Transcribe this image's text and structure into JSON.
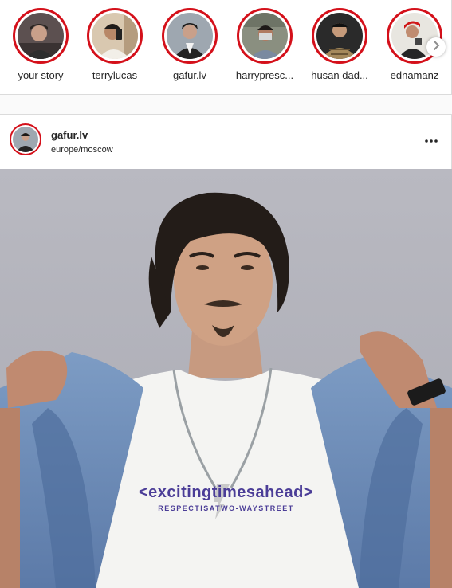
{
  "stories": [
    {
      "label": "your story",
      "avatar_bg": "#5c5050",
      "skin": "#c9a08a"
    },
    {
      "label": "terrylucas",
      "avatar_bg": "#d9c8b0",
      "skin": "#b88868"
    },
    {
      "label": "gafur.lv",
      "avatar_bg": "#9ea7b0",
      "skin": "#c9a08a"
    },
    {
      "label": "harrypresc...",
      "avatar_bg": "#8a8f80",
      "skin": "#b07a60"
    },
    {
      "label": "husan dad...",
      "avatar_bg": "#2a2a2a",
      "skin": "#c59a7a"
    },
    {
      "label": "ednamanz",
      "avatar_bg": "#e8e6e0",
      "skin": "#c08c70"
    }
  ],
  "post": {
    "username": "gafur.lv",
    "location": "europe/moscow",
    "shirt_main": "<excitingtimesahead>",
    "shirt_sub": "RESPECTISATWO-WAYSTREET"
  },
  "colors": {
    "ring": "#d4101a",
    "shirt_print": "#4b3d97",
    "border": "#dbdbdb"
  },
  "icons": {
    "next": "chevron-right-icon",
    "more": "more-horizontal-icon"
  }
}
